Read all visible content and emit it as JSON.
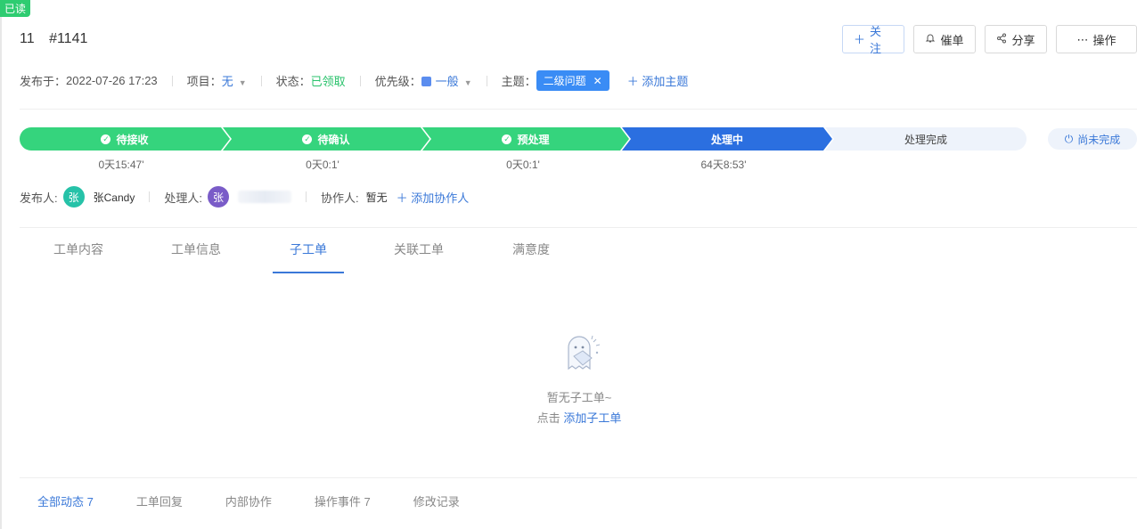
{
  "badge": "已读",
  "ticket": {
    "number": "11",
    "id": "#1141"
  },
  "actions": {
    "follow": "关注",
    "urge": "催单",
    "share": "分享",
    "operate": "操作"
  },
  "meta": {
    "published_label": "发布于：",
    "published_value": "2022-07-26 17:23",
    "project_label": "项目：",
    "project_value": "无",
    "status_label": "状态：",
    "status_value": "已领取",
    "priority_label": "优先级：",
    "priority_value": "一般",
    "topic_label": "主题：",
    "topic_tag": "二级问题",
    "add_topic": "添加主题"
  },
  "progress": {
    "steps": [
      {
        "label": "待接收",
        "duration": "0天15:47'"
      },
      {
        "label": "待确认",
        "duration": "0天0:1'"
      },
      {
        "label": "预处理",
        "duration": "0天0:1'"
      },
      {
        "label": "处理中",
        "duration": "64天8:53'"
      },
      {
        "label": "处理完成",
        "duration": ""
      }
    ],
    "unfinished": "尚未完成"
  },
  "people": {
    "publisher_label": "发布人:",
    "publisher_avatar": "张",
    "publisher_name": "张Candy",
    "handler_label": "处理人:",
    "handler_avatar": "张",
    "collab_label": "协作人:",
    "collab_value": "暂无",
    "add_collab": "添加协作人"
  },
  "tabs": [
    "工单内容",
    "工单信息",
    "子工单",
    "关联工单",
    "满意度"
  ],
  "empty": {
    "line1": "暂无子工单~",
    "prefix": "点击",
    "link": "添加子工单"
  },
  "bottom_tabs": [
    "全部动态 7",
    "工单回复",
    "内部协作",
    "操作事件 7",
    "修改记录"
  ],
  "colors": {
    "accent": "#3a78d8",
    "done": "#35d47d",
    "active_step": "#2b6fe0",
    "status_green": "#29c26b"
  }
}
